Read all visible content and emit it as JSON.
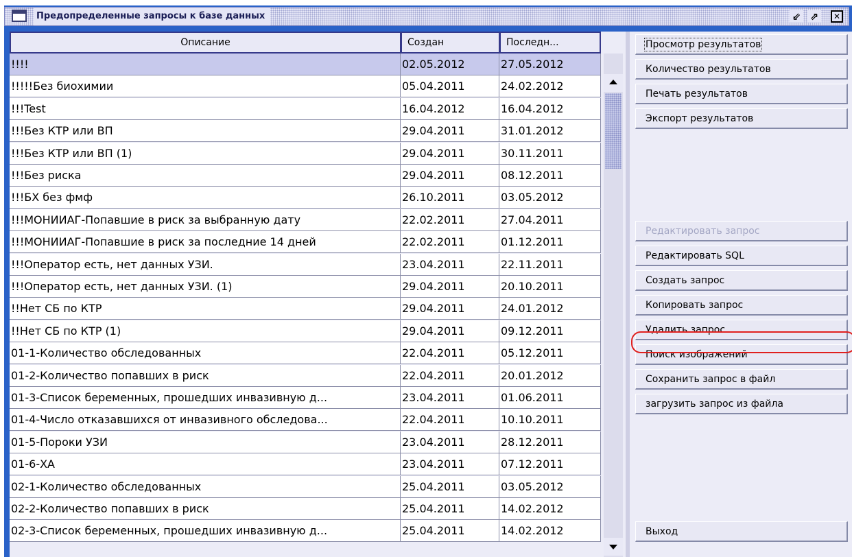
{
  "window": {
    "title": "Предопределенные запросы к базе данных",
    "restore_glyph": "⇙",
    "maximize_glyph": "⇗",
    "close_glyph": "✕",
    "icons": [
      "window-icon",
      "restore-icon",
      "maximize-icon",
      "close-icon"
    ]
  },
  "table": {
    "columns": [
      "Описание",
      "Создан",
      "Последн..."
    ],
    "rows": [
      {
        "description": "!!!!",
        "created": "02.05.2012",
        "last": "27.05.2012",
        "selected": true
      },
      {
        "description": "!!!!!Без биохимии",
        "created": "05.04.2011",
        "last": "24.02.2012"
      },
      {
        "description": "!!!Test",
        "created": "16.04.2012",
        "last": "16.04.2012"
      },
      {
        "description": "!!!Без КТР или ВП",
        "created": "29.04.2011",
        "last": "31.01.2012"
      },
      {
        "description": "!!!Без КТР или ВП (1)",
        "created": "29.04.2011",
        "last": "30.11.2011"
      },
      {
        "description": "!!!Без риска",
        "created": "29.04.2011",
        "last": "08.12.2011"
      },
      {
        "description": "!!!БХ без фмф",
        "created": "26.10.2011",
        "last": "03.05.2012"
      },
      {
        "description": "!!!МОНИИАГ-Попавшие в риск за выбранную дату",
        "created": "22.02.2011",
        "last": "27.04.2011"
      },
      {
        "description": "!!!МОНИИАГ-Попавшие в риск за последние 14 дней",
        "created": "22.02.2011",
        "last": "01.12.2011"
      },
      {
        "description": "!!!Оператор есть, нет данных УЗИ.",
        "created": "23.04.2011",
        "last": "22.11.2011"
      },
      {
        "description": "!!!Оператор есть, нет данных УЗИ. (1)",
        "created": "29.04.2011",
        "last": "20.10.2011"
      },
      {
        "description": "!!Нет СБ по КТР",
        "created": "29.04.2011",
        "last": "24.01.2012"
      },
      {
        "description": "!!Нет СБ по КТР (1)",
        "created": "29.04.2011",
        "last": "09.12.2011"
      },
      {
        "description": "01-1-Количество обследованных",
        "created": "22.04.2011",
        "last": "05.12.2011"
      },
      {
        "description": "01-2-Количество попавших в риск",
        "created": "22.04.2011",
        "last": "20.01.2012"
      },
      {
        "description": "01-3-Список беременных, прошедших инвазивную д...",
        "created": "23.04.2011",
        "last": "01.06.2011"
      },
      {
        "description": "01-4-Число отказавшихся от инвазивного обследова...",
        "created": "22.04.2011",
        "last": "10.10.2011"
      },
      {
        "description": "01-5-Пороки УЗИ",
        "created": "23.04.2011",
        "last": "28.12.2011"
      },
      {
        "description": "01-6-ХА",
        "created": "23.04.2011",
        "last": "07.12.2011"
      },
      {
        "description": "02-1-Количество обследованных",
        "created": "25.04.2011",
        "last": "03.05.2012"
      },
      {
        "description": "02-2-Количество попавших в риск",
        "created": "25.04.2011",
        "last": "14.02.2012"
      },
      {
        "description": "02-3-Список беременных, прошедших инвазивную д...",
        "created": "25.04.2011",
        "last": "14.02.2012"
      }
    ]
  },
  "buttons": [
    {
      "label": "Просмотр результатов",
      "name": "view-results-button",
      "focus": true
    },
    {
      "label": "Количество результатов",
      "name": "count-results-button"
    },
    {
      "label": "Печать результатов",
      "name": "print-results-button"
    },
    {
      "label": "Экспорт результатов",
      "name": "export-results-button"
    },
    {
      "label": "Редактировать запрос",
      "name": "edit-query-button",
      "disabled": true
    },
    {
      "label": "Редактировать SQL",
      "name": "edit-sql-button"
    },
    {
      "label": "Создать запрос",
      "name": "create-query-button",
      "highlighted": true
    },
    {
      "label": "Копировать запрос",
      "name": "copy-query-button"
    },
    {
      "label": "Удалить запрос",
      "name": "delete-query-button"
    },
    {
      "label": "Поиск изображений",
      "name": "search-images-button"
    },
    {
      "label": "Сохранить запрос в файл",
      "name": "save-query-to-file-button"
    },
    {
      "label": "загрузить запрос из файла",
      "name": "load-query-from-file-button"
    },
    {
      "label": "Выход",
      "name": "exit-button"
    }
  ],
  "colors": {
    "highlight_oval": "#e0201e",
    "selected_row": "#c7c9ec",
    "window_border": "#2a62c8"
  }
}
